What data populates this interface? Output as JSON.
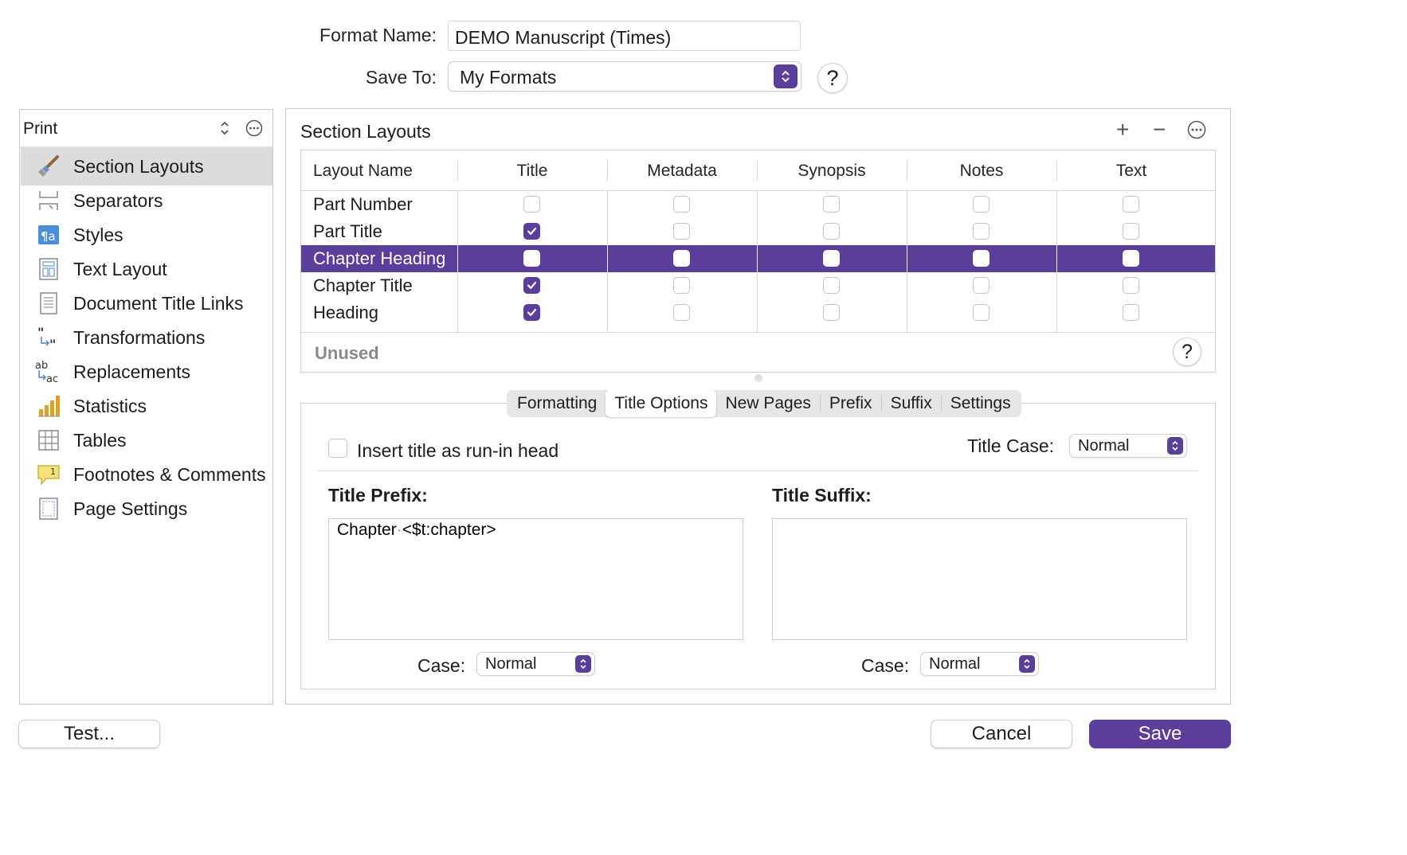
{
  "header": {
    "format_name_label": "Format Name:",
    "format_name_value": "DEMO Manuscript (Times)",
    "save_to_label": "Save To:",
    "save_to_value": "My Formats",
    "help": "?"
  },
  "sidebar": {
    "selector": "Print",
    "items": [
      {
        "label": "Section Layouts",
        "icon": "brush-icon",
        "selected": true
      },
      {
        "label": "Separators",
        "icon": "separator-icon"
      },
      {
        "label": "Styles",
        "icon": "styles-icon"
      },
      {
        "label": "Text Layout",
        "icon": "text-layout-icon"
      },
      {
        "label": "Document Title Links",
        "icon": "document-icon"
      },
      {
        "label": "Transformations",
        "icon": "quotes-icon"
      },
      {
        "label": "Replacements",
        "icon": "replace-icon"
      },
      {
        "label": "Statistics",
        "icon": "bar-chart-icon"
      },
      {
        "label": "Tables",
        "icon": "table-icon"
      },
      {
        "label": "Footnotes & Comments",
        "icon": "footnote-icon"
      },
      {
        "label": "Page Settings",
        "icon": "page-icon"
      }
    ]
  },
  "main": {
    "title": "Section Layouts",
    "add": "+",
    "remove": "−",
    "columns": [
      "Layout Name",
      "Title",
      "Metadata",
      "Synopsis",
      "Notes",
      "Text"
    ],
    "rows": [
      {
        "name": "Part Number",
        "checks": [
          false,
          false,
          false,
          false,
          false
        ]
      },
      {
        "name": "Part Title",
        "checks": [
          true,
          false,
          false,
          false,
          false
        ]
      },
      {
        "name": "Chapter Heading",
        "checks": [
          false,
          false,
          false,
          false,
          false
        ],
        "selected": true
      },
      {
        "name": "Chapter Title",
        "checks": [
          true,
          false,
          false,
          false,
          false
        ]
      },
      {
        "name": "Heading",
        "checks": [
          true,
          false,
          false,
          false,
          false
        ]
      }
    ],
    "unused_label": "Unused",
    "help": "?"
  },
  "tabs": [
    "Formatting",
    "Title Options",
    "New Pages",
    "Prefix",
    "Suffix",
    "Settings"
  ],
  "selected_tab": "Title Options",
  "options": {
    "run_in_label": "Insert title as run-in head",
    "run_in_checked": false,
    "title_case_label": "Title Case:",
    "title_case_value": "Normal",
    "prefix_label": "Title Prefix:",
    "prefix_value": "Chapter <$t:chapter>",
    "prefix_word1": "Chapter",
    "prefix_word2": "<$t:chapter>",
    "suffix_label": "Title Suffix:",
    "suffix_value": "",
    "case_label": "Case:",
    "prefix_case_value": "Normal",
    "suffix_case_value": "Normal"
  },
  "buttons": {
    "test": "Test...",
    "cancel": "Cancel",
    "save": "Save"
  },
  "colors": {
    "accent": "#5b3e9a",
    "selection_gray": "#dcdcdc"
  }
}
